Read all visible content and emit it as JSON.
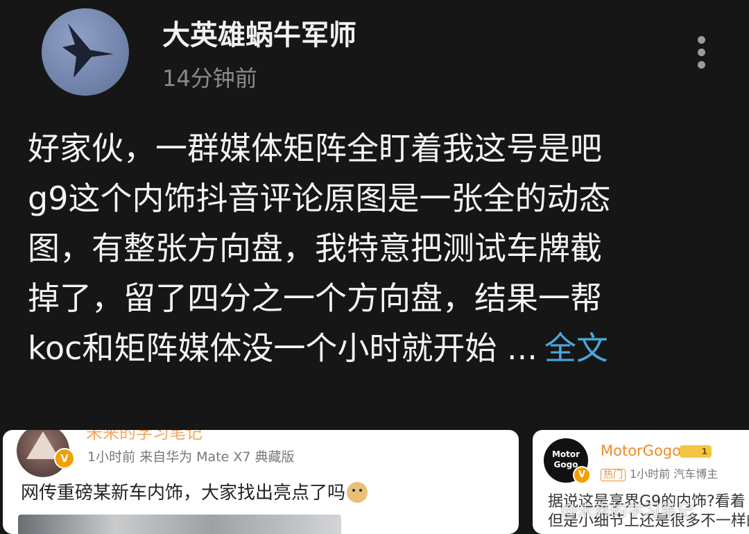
{
  "post": {
    "author": "大英雄蜗牛军师",
    "time": "14分钟前",
    "lines": [
      "好家伙，一群媒体矩阵全盯着我这号是吧",
      "g9这个内饰抖音评论原图是一张全的动态",
      "图，有整张方向盘，我特意把测试车牌截",
      "掉了，留了四分之一个方向盘，结果一帮",
      "koc和矩阵媒体没一个小时就开始 ..."
    ],
    "full_text_label": "全文"
  },
  "card1": {
    "name": "未来的学习笔记",
    "meta": "1小时前  来自华为 Mate X7 典藏版",
    "text": "网传重磅某新车内饰，大家找出亮点了吗",
    "badge": "V"
  },
  "card2": {
    "avatar_text": "Motor Gogo",
    "name": "MotorGogo",
    "level": "1",
    "hot": "热门",
    "meta": "1小时前  汽车博主",
    "line1": "据说这是享界G9的内饰?看着",
    "line2": "但是小细节上还是很多不一样的",
    "badge": "V"
  },
  "watermark": "@未来的学习笔记"
}
